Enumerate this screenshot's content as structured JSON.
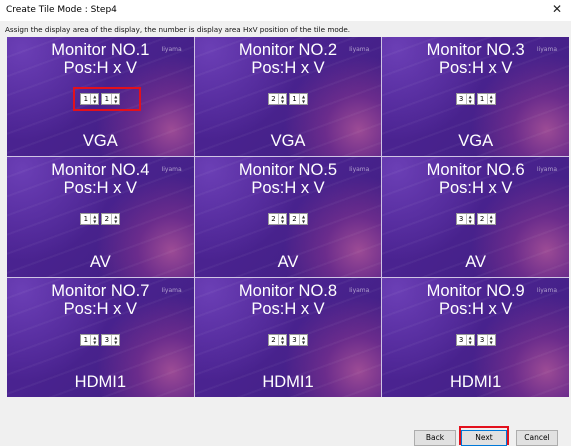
{
  "window": {
    "title": "Create Tile Mode : Step4",
    "close_glyph": "✕"
  },
  "instruction": "Assign the display area of the display, the number is display area HxV position of the tile mode.",
  "brand_mark": "Iiyama",
  "tiles": [
    {
      "monitor": "Monitor NO.1",
      "pos_label": "Pos:H x V",
      "h": "1",
      "v": "1",
      "input": "VGA"
    },
    {
      "monitor": "Monitor NO.2",
      "pos_label": "Pos:H x V",
      "h": "2",
      "v": "1",
      "input": "VGA"
    },
    {
      "monitor": "Monitor NO.3",
      "pos_label": "Pos:H x V",
      "h": "3",
      "v": "1",
      "input": "VGA"
    },
    {
      "monitor": "Monitor NO.4",
      "pos_label": "Pos:H x V",
      "h": "1",
      "v": "2",
      "input": "AV"
    },
    {
      "monitor": "Monitor NO.5",
      "pos_label": "Pos:H x V",
      "h": "2",
      "v": "2",
      "input": "AV"
    },
    {
      "monitor": "Monitor NO.6",
      "pos_label": "Pos:H x V",
      "h": "3",
      "v": "2",
      "input": "AV"
    },
    {
      "monitor": "Monitor NO.7",
      "pos_label": "Pos:H x V",
      "h": "1",
      "v": "3",
      "input": "HDMI1"
    },
    {
      "monitor": "Monitor NO.8",
      "pos_label": "Pos:H x V",
      "h": "2",
      "v": "3",
      "input": "HDMI1"
    },
    {
      "monitor": "Monitor NO.9",
      "pos_label": "Pos:H x V",
      "h": "3",
      "v": "3",
      "input": "HDMI1"
    }
  ],
  "spinner": {
    "up_glyph": "▲",
    "down_glyph": "▼"
  },
  "buttons": {
    "back": "Back",
    "next": "Next",
    "cancel": "Cancel"
  },
  "colors": {
    "tile_background": "#4a2390",
    "highlight": "#e3101c",
    "dialog_background": "#f0f0f0"
  }
}
